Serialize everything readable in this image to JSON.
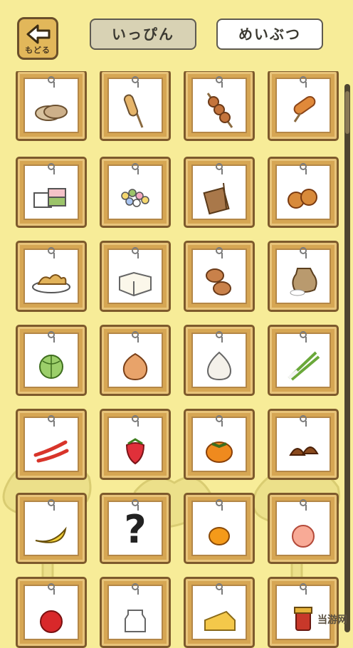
{
  "header": {
    "back_label": "もどる",
    "tabs": [
      {
        "label": "いっぴん",
        "active": true
      },
      {
        "label": "めいぶつ",
        "active": false
      }
    ]
  },
  "items": [
    {
      "icon": "rice-cracker-icon"
    },
    {
      "icon": "corn-dog-icon"
    },
    {
      "icon": "dango-skewer-icon"
    },
    {
      "icon": "grilled-fish-cake-icon"
    },
    {
      "icon": "layered-mochi-icon"
    },
    {
      "icon": "colorful-candy-icon"
    },
    {
      "icon": "tea-bag-icon"
    },
    {
      "icon": "senbei-crackers-icon"
    },
    {
      "icon": "fried-tempura-icon"
    },
    {
      "icon": "tofu-block-icon"
    },
    {
      "icon": "bread-buns-icon"
    },
    {
      "icon": "rice-sack-icon"
    },
    {
      "icon": "cabbage-icon"
    },
    {
      "icon": "onion-icon"
    },
    {
      "icon": "garlic-icon"
    },
    {
      "icon": "green-onion-icon"
    },
    {
      "icon": "chili-pepper-icon"
    },
    {
      "icon": "strawberry-icon"
    },
    {
      "icon": "persimmon-icon"
    },
    {
      "icon": "chestnut-icon"
    },
    {
      "icon": "banana-icon"
    },
    {
      "icon": "unknown-item-icon",
      "label": "?"
    },
    {
      "icon": "mandarin-orange-icon"
    },
    {
      "icon": "peach-icon"
    },
    {
      "icon": "apple-icon"
    },
    {
      "icon": "milk-jug-icon"
    },
    {
      "icon": "cheese-icon"
    },
    {
      "icon": "jam-jar-icon"
    }
  ],
  "watermark": "当游网"
}
